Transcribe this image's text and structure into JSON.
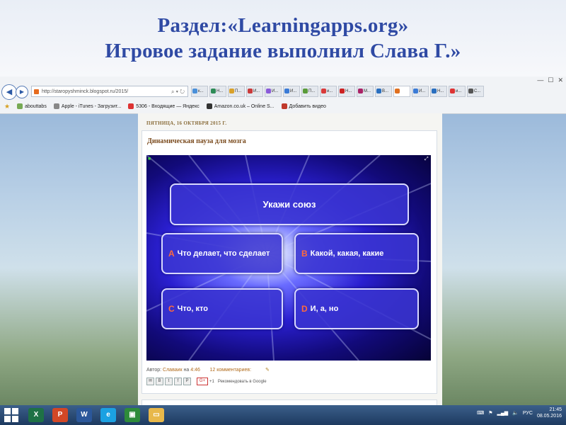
{
  "slide": {
    "title_line1": "Раздел:«Learningapps.org»",
    "title_line2": "Игровое задание выполнил Слава Г.»"
  },
  "browser": {
    "url": "http://staropyshminck.blogspot.ru/2015/",
    "tabs": [
      "к...",
      "Н...",
      "П...",
      "И...",
      "И...",
      "И...",
      "П...",
      "и...",
      "Н...",
      "М...",
      "В...",
      "",
      "И...",
      "Н...",
      "и...",
      "С..."
    ],
    "tab_colors": [
      "#4a90d9",
      "#2e8b57",
      "#d9a12a",
      "#ca3a3a",
      "#8a5ad9",
      "#3b7bd6",
      "#5a9b3a",
      "#d93a3a",
      "#c22",
      "#aa2266",
      "#2a6fbf",
      "#e07020",
      "#3b7bd6",
      "#2a6fbf",
      "#d33",
      "#555"
    ],
    "favorites": [
      {
        "label": "abouttabs",
        "color": "#7a5"
      },
      {
        "label": "Apple - iTunes - Загрузит...",
        "color": "#888"
      },
      {
        "label": "5306 - Входящие — Яндекс",
        "color": "#d33"
      },
      {
        "label": "Amazon.co.uk – Online S...",
        "color": "#333"
      },
      {
        "label": "Добавить видео",
        "color": "#c0392b"
      }
    ]
  },
  "post": {
    "date": "ПЯТНИЦА, 16 ОКТЯБРЯ 2015 Г.",
    "title": "Динамическая пауза для мозга",
    "author_prefix": "Автор:",
    "author": "Славаик",
    "time_prefix": "на",
    "time": "4:46",
    "comments": "12 комментариев:",
    "share_label": "Рекомендовать в Google",
    "gplus_count": "+1"
  },
  "game": {
    "question": "Укажи союз",
    "options": [
      {
        "letter": "A",
        "text": "Что делает, что сделает"
      },
      {
        "letter": "B",
        "text": "Какой, какая, какие"
      },
      {
        "letter": "C",
        "text": "Что, кто"
      },
      {
        "letter": "D",
        "text": "И, а, но"
      }
    ]
  },
  "taskbar": {
    "apps": [
      {
        "name": "excel",
        "glyph": "X",
        "color": "#1e7145"
      },
      {
        "name": "powerpoint",
        "glyph": "P",
        "color": "#d24726"
      },
      {
        "name": "word",
        "glyph": "W",
        "color": "#2b579a"
      },
      {
        "name": "ie",
        "glyph": "e",
        "color": "#1ba1e2"
      },
      {
        "name": "store",
        "glyph": "▣",
        "color": "#2e8b3a"
      },
      {
        "name": "explorer",
        "glyph": "▭",
        "color": "#e8b84a"
      }
    ],
    "lang": "РУС",
    "time": "21:45",
    "date": "08.05.2016"
  }
}
